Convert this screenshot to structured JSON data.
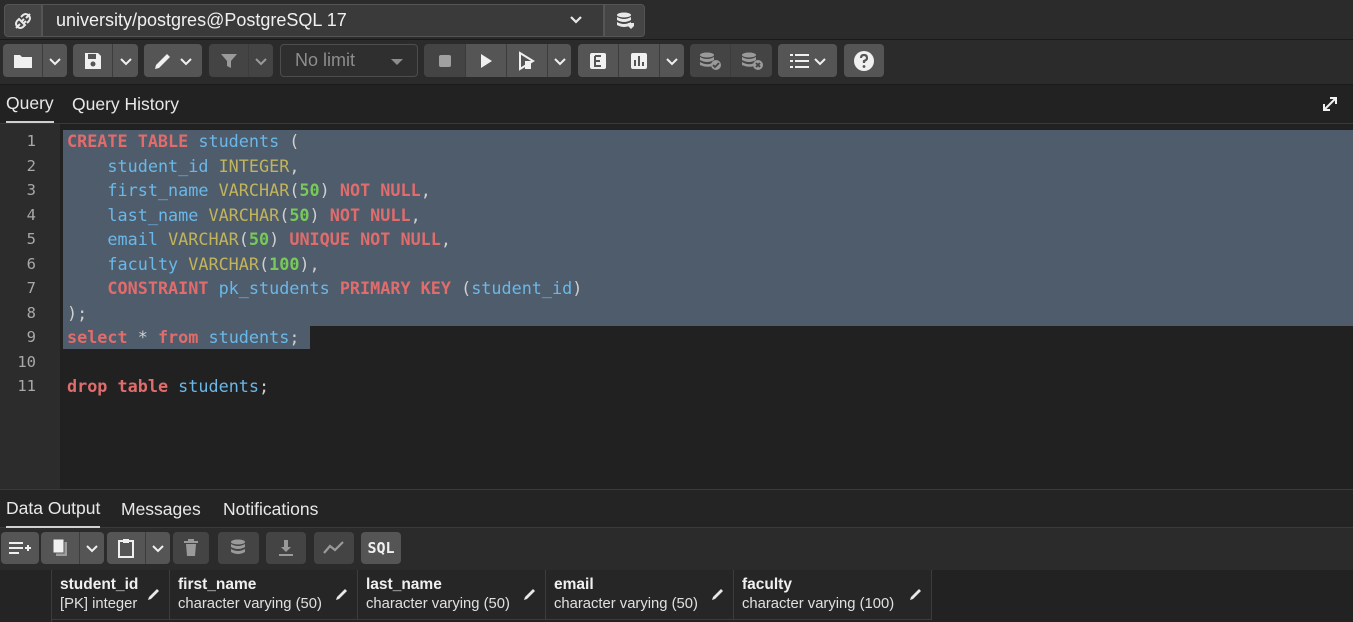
{
  "connection": {
    "label": "university/postgres@PostgreSQL 17"
  },
  "toolbar": {
    "limit_value": "No limit"
  },
  "query_tabs": [
    {
      "label": "Query",
      "active": true
    },
    {
      "label": "Query History",
      "active": false
    }
  ],
  "editor": {
    "line_numbers": [
      "1",
      "2",
      "3",
      "4",
      "5",
      "6",
      "7",
      "8",
      "9",
      "10",
      "11"
    ]
  },
  "output_tabs": [
    {
      "label": "Data Output",
      "active": true
    },
    {
      "label": "Messages",
      "active": false
    },
    {
      "label": "Notifications",
      "active": false
    }
  ],
  "output_toolbar": {
    "sql_label": "SQL"
  },
  "columns": [
    {
      "name": "student_id",
      "type": "[PK] integer"
    },
    {
      "name": "first_name",
      "type": "character varying (50)"
    },
    {
      "name": "last_name",
      "type": "character varying (50)"
    },
    {
      "name": "email",
      "type": "character varying (50)"
    },
    {
      "name": "faculty",
      "type": "character varying (100)"
    }
  ],
  "colors": {
    "keyword": "#e06c6c",
    "identifier": "#6ab8e9",
    "type": "#c2b45a",
    "number": "#78c95a",
    "selection": "#4f5c6b"
  }
}
